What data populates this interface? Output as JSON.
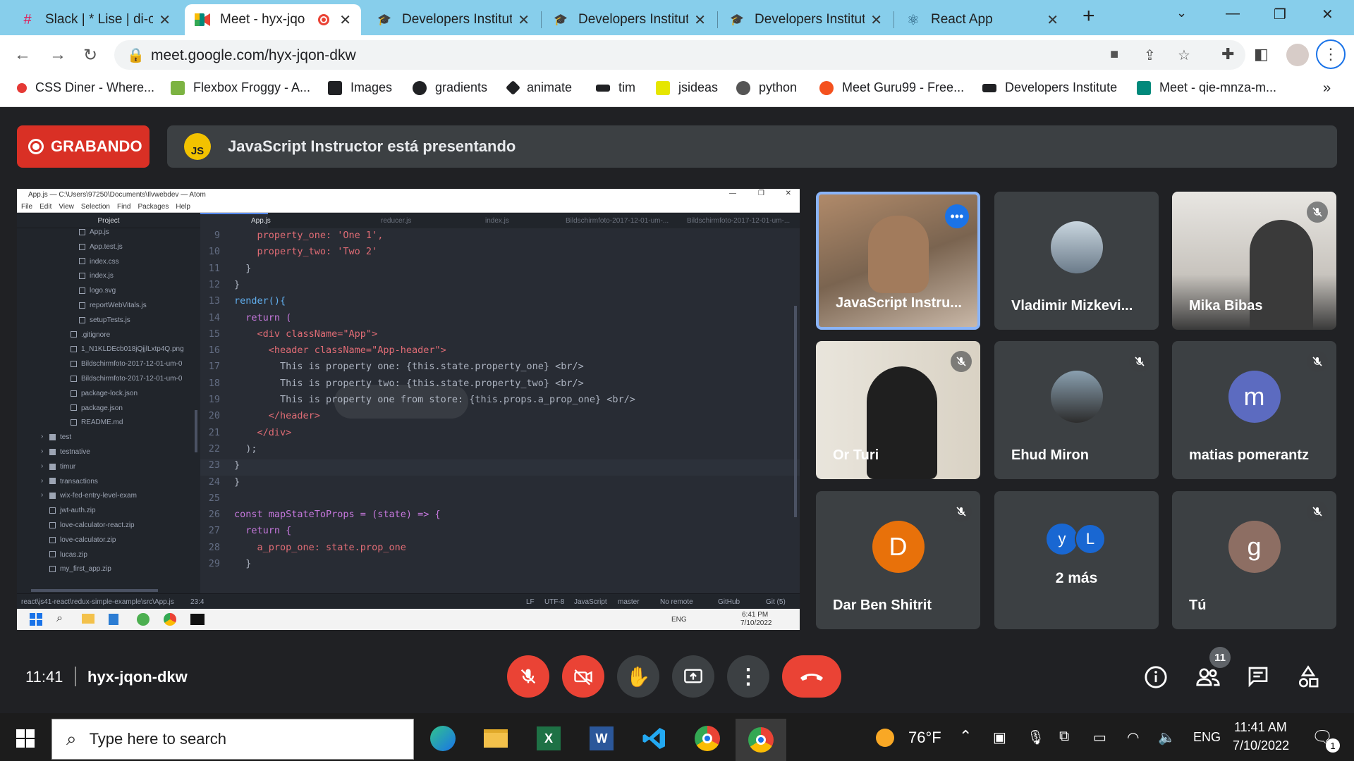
{
  "browser": {
    "tabs": [
      {
        "label": "Slack | * Lise | di-cla",
        "icon": "slack-icon",
        "active": false
      },
      {
        "label": "Meet - hyx-jqo",
        "icon": "meet-icon",
        "active": true
      },
      {
        "label": "Developers Institut",
        "icon": "graduation-cap-icon",
        "active": false
      },
      {
        "label": "Developers Institut",
        "icon": "graduation-cap-icon",
        "active": false
      },
      {
        "label": "Developers Institut",
        "icon": "graduation-cap-icon",
        "active": false
      },
      {
        "label": "React App",
        "icon": "react-icon",
        "active": false
      }
    ],
    "url": "meet.google.com/hyx-jqon-dkw",
    "bookmarks": [
      {
        "label": "CSS Diner - Where...",
        "color": "#e53935"
      },
      {
        "label": "Flexbox Froggy - A...",
        "color": "#7cb342"
      },
      {
        "label": "Images",
        "color": "#202124"
      },
      {
        "label": "gradients",
        "color": "#202124"
      },
      {
        "label": "animate",
        "color": "#202124"
      },
      {
        "label": "tim",
        "color": "#202124"
      },
      {
        "label": "jsideas",
        "color": "#e6e600"
      },
      {
        "label": "python",
        "color": "#555555"
      },
      {
        "label": "Meet Guru99 - Free...",
        "color": "#f4511e"
      },
      {
        "label": "Developers Institute",
        "color": "#202124"
      },
      {
        "label": "Meet - qie-mnza-m...",
        "color": "#00897b"
      }
    ]
  },
  "meet": {
    "recording_label": "GRABANDO",
    "presenter_initials": "JS",
    "presenting_text": "JavaScript Instructor está presentando",
    "participants": [
      {
        "name": "JavaScript Instru...",
        "kind": "video",
        "muted": false,
        "highlight": true
      },
      {
        "name": "Vladimir Mizkevi...",
        "kind": "photo",
        "muted": false
      },
      {
        "name": "Mika Bibas",
        "kind": "video",
        "muted": true
      },
      {
        "name": "Or Turi",
        "kind": "video",
        "muted": true
      },
      {
        "name": "Ehud Miron",
        "kind": "photo",
        "muted": true
      },
      {
        "name": "matias pomerantz",
        "kind": "letter",
        "letter": "m",
        "color": "#5c6bc0",
        "muted": true
      },
      {
        "name": "Dar Ben Shitrit",
        "kind": "letter",
        "letter": "D",
        "color": "#e8710a",
        "muted": true
      },
      {
        "name": "2 más",
        "kind": "more",
        "letters": [
          "y",
          "L"
        ],
        "colors": [
          "#1967d2",
          "#1967d2"
        ],
        "muted": false
      },
      {
        "name": "Tú",
        "kind": "letter",
        "letter": "g",
        "color": "#8d6e63",
        "muted": true
      }
    ],
    "time": "11:41",
    "meeting_code": "hyx-jqon-dkw",
    "participant_count": "11"
  },
  "atom": {
    "title": "App.js — C:\\Users\\97250\\Documents\\Ilvwebdev — Atom",
    "menu": [
      "File",
      "Edit",
      "View",
      "Selection",
      "Find",
      "Packages",
      "Help"
    ],
    "tree_header": "Project",
    "tree": [
      {
        "label": "App.js",
        "indent": 2,
        "type": "file"
      },
      {
        "label": "App.test.js",
        "indent": 2,
        "type": "file"
      },
      {
        "label": "index.css",
        "indent": 2,
        "type": "file"
      },
      {
        "label": "index.js",
        "indent": 2,
        "type": "file"
      },
      {
        "label": "logo.svg",
        "indent": 2,
        "type": "file"
      },
      {
        "label": "reportWebVitals.js",
        "indent": 2,
        "type": "file"
      },
      {
        "label": "setupTests.js",
        "indent": 2,
        "type": "file"
      },
      {
        "label": ".gitignore",
        "indent": 1,
        "type": "file"
      },
      {
        "label": "1_N1KLDEcb018jQjjlLxtp4Q.png",
        "indent": 1,
        "type": "file"
      },
      {
        "label": "Bildschirmfoto-2017-12-01-um-0",
        "indent": 1,
        "type": "file"
      },
      {
        "label": "Bildschirmfoto-2017-12-01-um-0",
        "indent": 1,
        "type": "file"
      },
      {
        "label": "package-lock.json",
        "indent": 1,
        "type": "file"
      },
      {
        "label": "package.json",
        "indent": 1,
        "type": "file"
      },
      {
        "label": "README.md",
        "indent": 1,
        "type": "file"
      },
      {
        "label": "test",
        "indent": 0,
        "type": "folder"
      },
      {
        "label": "testnative",
        "indent": 0,
        "type": "folder"
      },
      {
        "label": "timur",
        "indent": 0,
        "type": "folder"
      },
      {
        "label": "transactions",
        "indent": 0,
        "type": "folder"
      },
      {
        "label": "wix-fed-entry-level-exam",
        "indent": 0,
        "type": "folder"
      },
      {
        "label": "jwt-auth.zip",
        "indent": 0,
        "type": "file"
      },
      {
        "label": "love-calculator-react.zip",
        "indent": 0,
        "type": "file"
      },
      {
        "label": "love-calculator.zip",
        "indent": 0,
        "type": "file"
      },
      {
        "label": "lucas.zip",
        "indent": 0,
        "type": "file"
      },
      {
        "label": "my_first_app.zip",
        "indent": 0,
        "type": "file"
      }
    ],
    "tabs": [
      "App.js",
      "reducer.js",
      "index.js",
      "Bildschirmfoto-2017-12-01-um-...",
      "Bildschirmfoto-2017-12-01-um-..."
    ],
    "lines": [
      {
        "n": "9",
        "code": "    property_one: 'One 1',"
      },
      {
        "n": "10",
        "code": "    property_two: 'Two 2'"
      },
      {
        "n": "11",
        "code": "  }"
      },
      {
        "n": "12",
        "code": "}"
      },
      {
        "n": "13",
        "code": "render(){"
      },
      {
        "n": "14",
        "code": "  return ("
      },
      {
        "n": "15",
        "code": "    <div className=\"App\">"
      },
      {
        "n": "16",
        "code": "      <header className=\"App-header\">"
      },
      {
        "n": "17",
        "code": "        This is property one: {this.state.property_one} <br/>"
      },
      {
        "n": "18",
        "code": "        This is property two: {this.state.property_two} <br/>"
      },
      {
        "n": "19",
        "code": "        This is property one from store: {this.props.a_prop_one} <br/>"
      },
      {
        "n": "20",
        "code": "      </header>"
      },
      {
        "n": "21",
        "code": "    </div>"
      },
      {
        "n": "22",
        "code": "  );"
      },
      {
        "n": "23",
        "code": "}"
      },
      {
        "n": "24",
        "code": "}"
      },
      {
        "n": "25",
        "code": ""
      },
      {
        "n": "26",
        "code": "const mapStateToProps = (state) => {"
      },
      {
        "n": "27",
        "code": "  return {"
      },
      {
        "n": "28",
        "code": "    a_prop_one: state.prop_one"
      },
      {
        "n": "29",
        "code": "  }"
      }
    ],
    "status_path": "react\\js41-react\\redux-simple-example\\src\\App.js",
    "status_pos": "23:4",
    "status_right": [
      "LF",
      "UTF-8",
      "JavaScript",
      "master",
      "No remote",
      "GitHub",
      "Git (5)"
    ],
    "inner_task_tray": [
      "ENG",
      "6:41 PM",
      "7/10/2022"
    ]
  },
  "taskbar": {
    "search_placeholder": "Type here to search",
    "weather": "76°F",
    "lang": "ENG",
    "time": "11:41 AM",
    "date": "7/10/2022",
    "notification_count": "1"
  }
}
